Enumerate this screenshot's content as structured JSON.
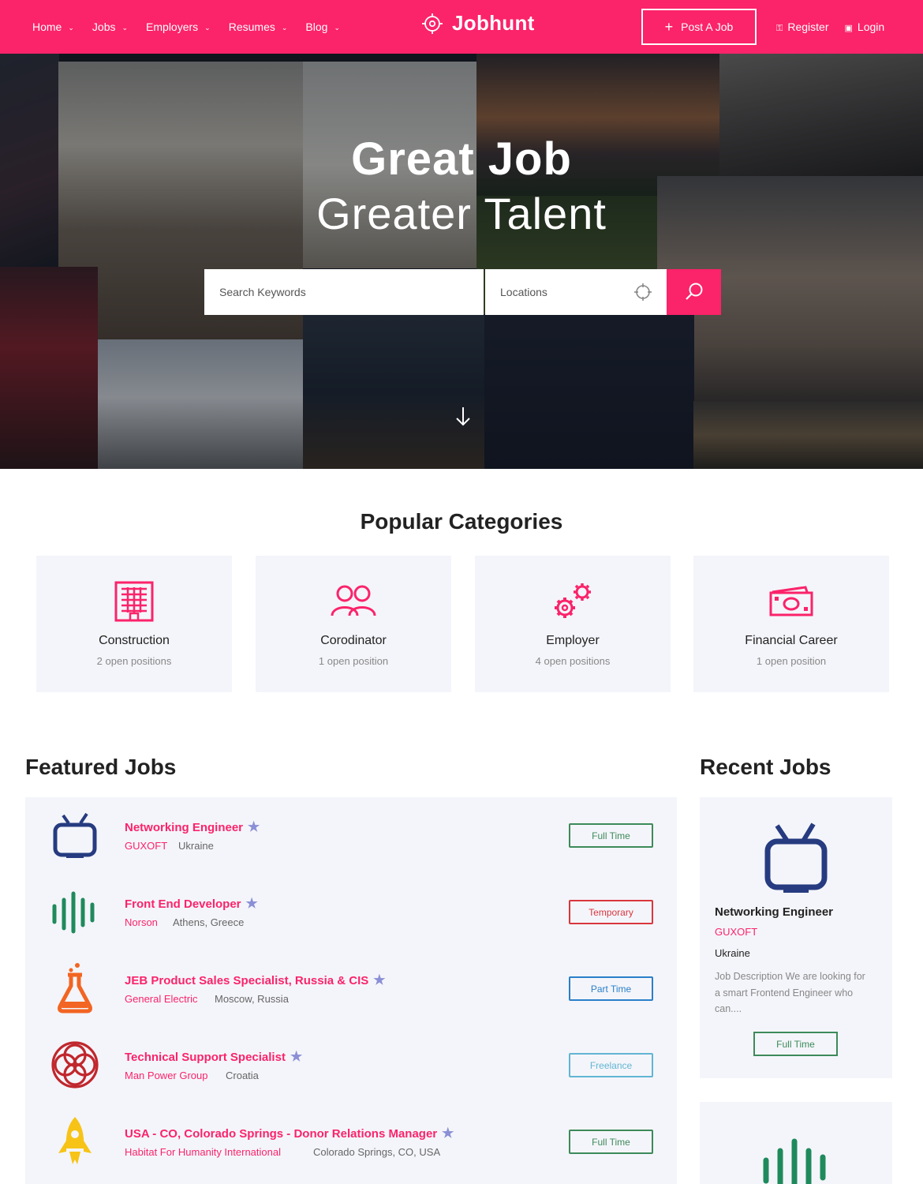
{
  "nav": {
    "items": [
      {
        "label": "Home"
      },
      {
        "label": "Jobs"
      },
      {
        "label": "Employers"
      },
      {
        "label": "Resumes"
      },
      {
        "label": "Blog"
      }
    ],
    "logo_text": "Jobhunt",
    "post_job": "Post A Job",
    "register": "Register",
    "login": "Login"
  },
  "hero": {
    "title": "Great Job",
    "subtitle": "Greater Talent",
    "search_placeholder": "Search Keywords",
    "location_placeholder": "Locations"
  },
  "categories": {
    "title": "Popular Categories",
    "items": [
      {
        "name": "Construction",
        "count": "2 open positions",
        "icon": "building-icon"
      },
      {
        "name": "Corodinator",
        "count": "1 open position",
        "icon": "users-icon"
      },
      {
        "name": "Employer",
        "count": "4 open positions",
        "icon": "gears-icon"
      },
      {
        "name": "Financial Career",
        "count": "1 open position",
        "icon": "money-icon"
      }
    ]
  },
  "featured": {
    "title": "Featured Jobs",
    "jobs": [
      {
        "title": "Networking Engineer",
        "company": "GUXOFT",
        "location": "Ukraine",
        "type": "Full Time",
        "logo": "tv-icon"
      },
      {
        "title": "Front End Developer",
        "company": "Norson",
        "location": "Athens, Greece",
        "type": "Temporary",
        "logo": "soundwave-icon"
      },
      {
        "title": "JEB Product Sales Specialist, Russia & CIS",
        "company": "General Electric",
        "location": "Moscow, Russia",
        "type": "Part Time",
        "logo": "flask-icon"
      },
      {
        "title": "Technical Support Specialist",
        "company": "Man Power Group",
        "location": "Croatia",
        "type": "Freelance",
        "logo": "rings-icon"
      },
      {
        "title": "USA - CO, Colorado Springs - Donor Relations Manager",
        "company": "Habitat For Humanity International",
        "location": "Colorado Springs, CO, USA",
        "type": "Full Time",
        "logo": "rocket-icon"
      }
    ]
  },
  "recent": {
    "title": "Recent Jobs",
    "job": {
      "title": "Networking Engineer",
      "company": "GUXOFT",
      "location": "Ukraine",
      "description": "Job Description We are looking for a smart Frontend Engineer who can....",
      "type": "Full Time"
    }
  },
  "colors": {
    "brand": "#fb236a",
    "full_time": "#3d8a5a",
    "temporary": "#d9363e",
    "part_time": "#2a7fc9",
    "freelance": "#62b5d3"
  }
}
